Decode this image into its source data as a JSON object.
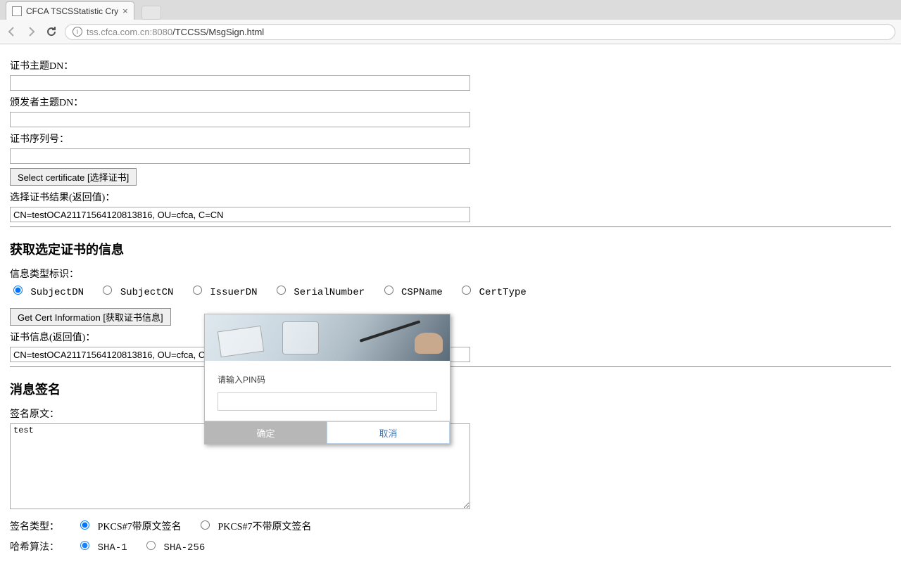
{
  "browser": {
    "tab_title": "CFCA TSCSStatistic Cry",
    "url_host": "tss.cfca.com.cn",
    "url_port": ":8080",
    "url_path": "/TCCSS/MsgSign.html"
  },
  "form": {
    "subject_dn_label": "证书主题DN：",
    "subject_dn_value": "",
    "issuer_dn_label": "颁发者主题DN：",
    "issuer_dn_value": "",
    "serial_label": "证书序列号：",
    "serial_value": "",
    "select_cert_button": "Select certificate [选择证书]",
    "select_result_label": "选择证书结果(返回值)：",
    "select_result_value": "CN=testOCA21171564120813816, OU=cfca, C=CN"
  },
  "cert_info": {
    "heading": "获取选定证书的信息",
    "infotype_label": "信息类型标识：",
    "options": {
      "subjectdn": "SubjectDN",
      "subjectcn": "SubjectCN",
      "issuerdn": "IssuerDN",
      "serial": "SerialNumber",
      "csp": "CSPName",
      "certtype": "CertType"
    },
    "get_info_button": "Get Cert Information [获取证书信息]",
    "cert_info_label": "证书信息(返回值)：",
    "cert_info_value": "CN=testOCA21171564120813816, OU=cfca, C"
  },
  "sign": {
    "heading": "消息签名",
    "source_label": "签名原文：",
    "source_value": "test",
    "sigtype_label": "签名类型：",
    "sigtype_options": {
      "attached": "PKCS#7带原文签名",
      "detached": "PKCS#7不带原文签名"
    },
    "hash_label": "哈希算法：",
    "hash_options": {
      "sha1": "SHA-1",
      "sha256": "SHA-256"
    }
  },
  "modal": {
    "prompt": "请输入PIN码",
    "ok": "确定",
    "cancel": "取消"
  }
}
